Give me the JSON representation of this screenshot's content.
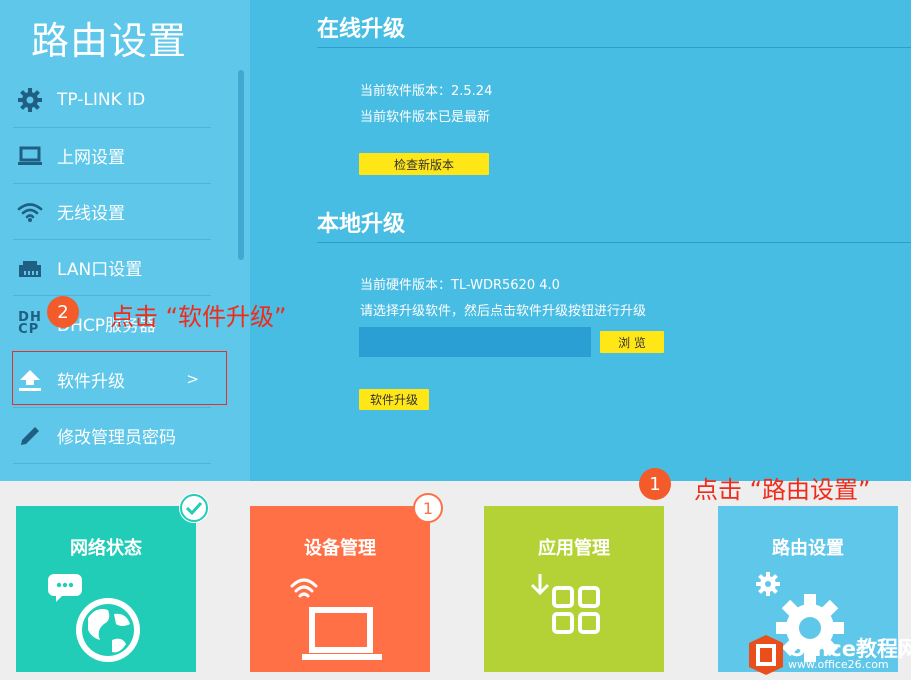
{
  "sidebar": {
    "title": "路由设置",
    "items": [
      {
        "label": "TP-LINK ID",
        "icon": "gear-icon"
      },
      {
        "label": "上网设置",
        "icon": "laptop-icon"
      },
      {
        "label": "无线设置",
        "icon": "wifi-icon"
      },
      {
        "label": "LAN口设置",
        "icon": "lan-port-icon"
      },
      {
        "label": "DHCP服务器",
        "icon": "dhcp-icon",
        "icon_text": "DH\nCP"
      },
      {
        "label": "软件升级",
        "icon": "upload-icon",
        "chevron": ">"
      },
      {
        "label": "修改管理员密码",
        "icon": "pencil-icon"
      }
    ]
  },
  "online_upgrade": {
    "title": "在线升级",
    "current_version": "当前软件版本：2.5.24",
    "status": "当前软件版本已是最新",
    "check_button": "检查新版本"
  },
  "local_upgrade": {
    "title": "本地升级",
    "hardware_version": "当前硬件版本：TL-WDR5620 4.0",
    "instruction": "请选择升级软件，然后点击软件升级按钮进行升级",
    "file_path": "",
    "browse_button": "浏 览",
    "upgrade_button": "软件升级"
  },
  "tiles": [
    {
      "label": "网络状态",
      "color": "#22cdb8",
      "icon": "globe-chat-icon",
      "badge": "check-badge-icon"
    },
    {
      "label": "设备管理",
      "color": "#ff7046",
      "icon": "laptop-wifi-icon",
      "badge_count": "1"
    },
    {
      "label": "应用管理",
      "color": "#b4d235",
      "icon": "apps-grid-icon"
    },
    {
      "label": "路由设置",
      "color": "#5ec7ea",
      "icon": "gears-icon"
    }
  ],
  "annotations": {
    "step1_number": "1",
    "step1_text": "点击 “路由设置”",
    "step2_number": "2",
    "step2_text": "点击 “软件升级”"
  },
  "watermark": {
    "name": "Office教程网",
    "url": "www.office26.com"
  },
  "colors": {
    "sidebar_bg": "#5ec7ea",
    "main_bg": "#48bde3",
    "button_yellow": "#ffe617",
    "annotation_red": "#f02b1a",
    "step_orange": "#f35b2a"
  }
}
